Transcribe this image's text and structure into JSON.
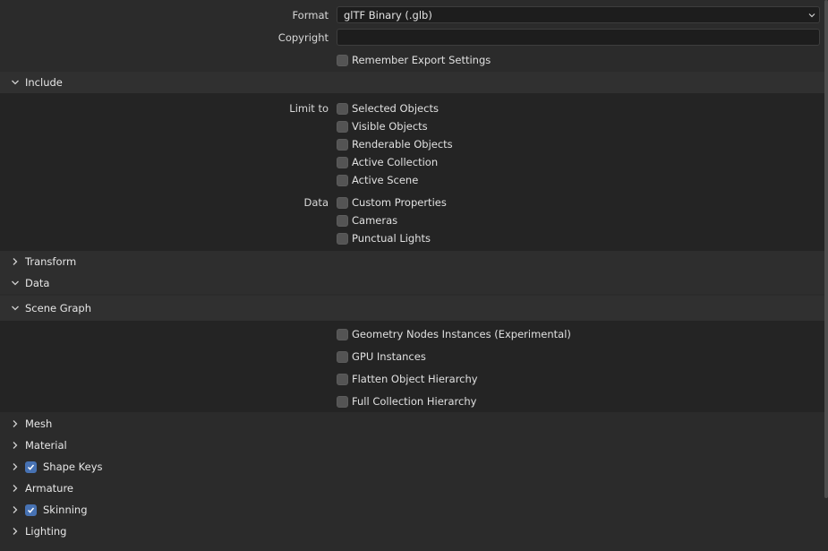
{
  "top": {
    "format_label": "Format",
    "format_value": "glTF Binary (.glb)",
    "copyright_label": "Copyright",
    "copyright_value": "",
    "remember_label": "Remember Export Settings",
    "remember_checked": false
  },
  "include": {
    "title": "Include",
    "limit_label": "Limit to",
    "limit_options": [
      {
        "label": "Selected Objects",
        "checked": false
      },
      {
        "label": "Visible Objects",
        "checked": false
      },
      {
        "label": "Renderable Objects",
        "checked": false
      },
      {
        "label": "Active Collection",
        "checked": false
      },
      {
        "label": "Active Scene",
        "checked": false
      }
    ],
    "data_label": "Data",
    "data_options": [
      {
        "label": "Custom Properties",
        "checked": false
      },
      {
        "label": "Cameras",
        "checked": false
      },
      {
        "label": "Punctual Lights",
        "checked": false
      }
    ]
  },
  "transform": {
    "title": "Transform"
  },
  "data": {
    "title": "Data"
  },
  "scene_graph": {
    "title": "Scene Graph",
    "options": [
      {
        "label": "Geometry Nodes Instances (Experimental)",
        "checked": false
      },
      {
        "label": "GPU Instances",
        "checked": false
      },
      {
        "label": "Flatten Object Hierarchy",
        "checked": false
      },
      {
        "label": "Full Collection Hierarchy",
        "checked": false
      }
    ]
  },
  "subpanels": [
    {
      "title": "Mesh",
      "has_checkbox": false
    },
    {
      "title": "Material",
      "has_checkbox": false
    },
    {
      "title": "Shape Keys",
      "has_checkbox": true,
      "checked": true
    },
    {
      "title": "Armature",
      "has_checkbox": false
    },
    {
      "title": "Skinning",
      "has_checkbox": true,
      "checked": true
    },
    {
      "title": "Lighting",
      "has_checkbox": false
    }
  ],
  "colors": {
    "background": "#2b2b2b",
    "panel_body": "#242424",
    "field": "#1d1d1d",
    "checkbox": "#545454",
    "checkbox_on": "#4772b3"
  }
}
